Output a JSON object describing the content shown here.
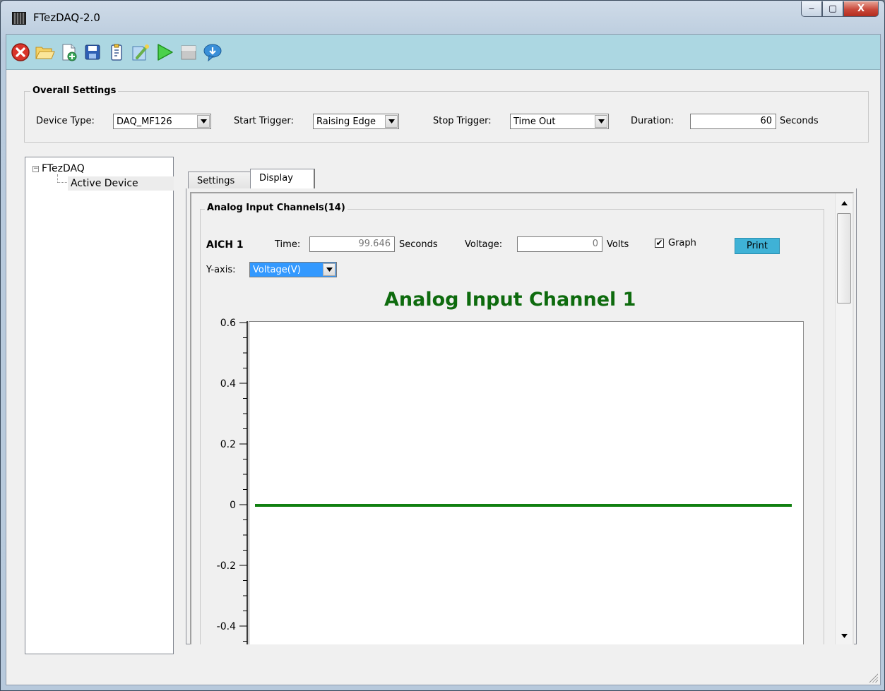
{
  "window": {
    "title": "FTezDAQ-2.0",
    "minimize": "‒",
    "maximize": "▢",
    "close": "X"
  },
  "toolbar": {
    "buttons": [
      {
        "icon": "close-circle-icon"
      },
      {
        "icon": "open-folder-icon"
      },
      {
        "icon": "new-document-icon"
      },
      {
        "icon": "save-icon"
      },
      {
        "icon": "clipboard-icon"
      },
      {
        "icon": "wand-icon"
      },
      {
        "icon": "play-icon"
      },
      {
        "icon": "stop-icon"
      },
      {
        "icon": "chat-info-icon"
      }
    ]
  },
  "overall": {
    "title": "Overall Settings",
    "device_type_label": "Device Type:",
    "device_type_value": "DAQ_MF126",
    "start_trigger_label": "Start Trigger:",
    "start_trigger_value": "Raising Edge",
    "stop_trigger_label": "Stop Trigger:",
    "stop_trigger_value": "Time Out",
    "duration_label": "Duration:",
    "duration_value": "60",
    "duration_unit": "Seconds"
  },
  "tree": {
    "root": "FTezDAQ",
    "expander": "−",
    "child": "Active Device"
  },
  "tabs": {
    "settings": "Settings",
    "display": "Display"
  },
  "channels": {
    "group_title": "Analog Input Channels(14)",
    "channel_name": "AICH 1",
    "time_label": "Time:",
    "time_value": "99.646",
    "time_unit": "Seconds",
    "voltage_label": "Voltage:",
    "voltage_value": "0",
    "voltage_unit": "Volts",
    "graph_label": "Graph",
    "graph_checked": "✔",
    "print_label": "Print",
    "yaxis_label": "Y-axis:",
    "yaxis_value": "Voltage(V)"
  },
  "colors": {
    "toolbar_bg": "#acd7e2",
    "line": "#118011",
    "title": "#0e6b0e",
    "print_bg": "#3fb2d6"
  },
  "chart_data": {
    "type": "line",
    "title": "Analog Input Channel 1",
    "xlabel": "",
    "ylabel": "",
    "ylim": [
      -0.45,
      0.6
    ],
    "yticks": [
      "0.6",
      "0.4",
      "0.2",
      "0",
      "-0.2",
      "-0.4"
    ],
    "series": [
      {
        "values": [
          0,
          0
        ]
      }
    ],
    "grid": false
  }
}
